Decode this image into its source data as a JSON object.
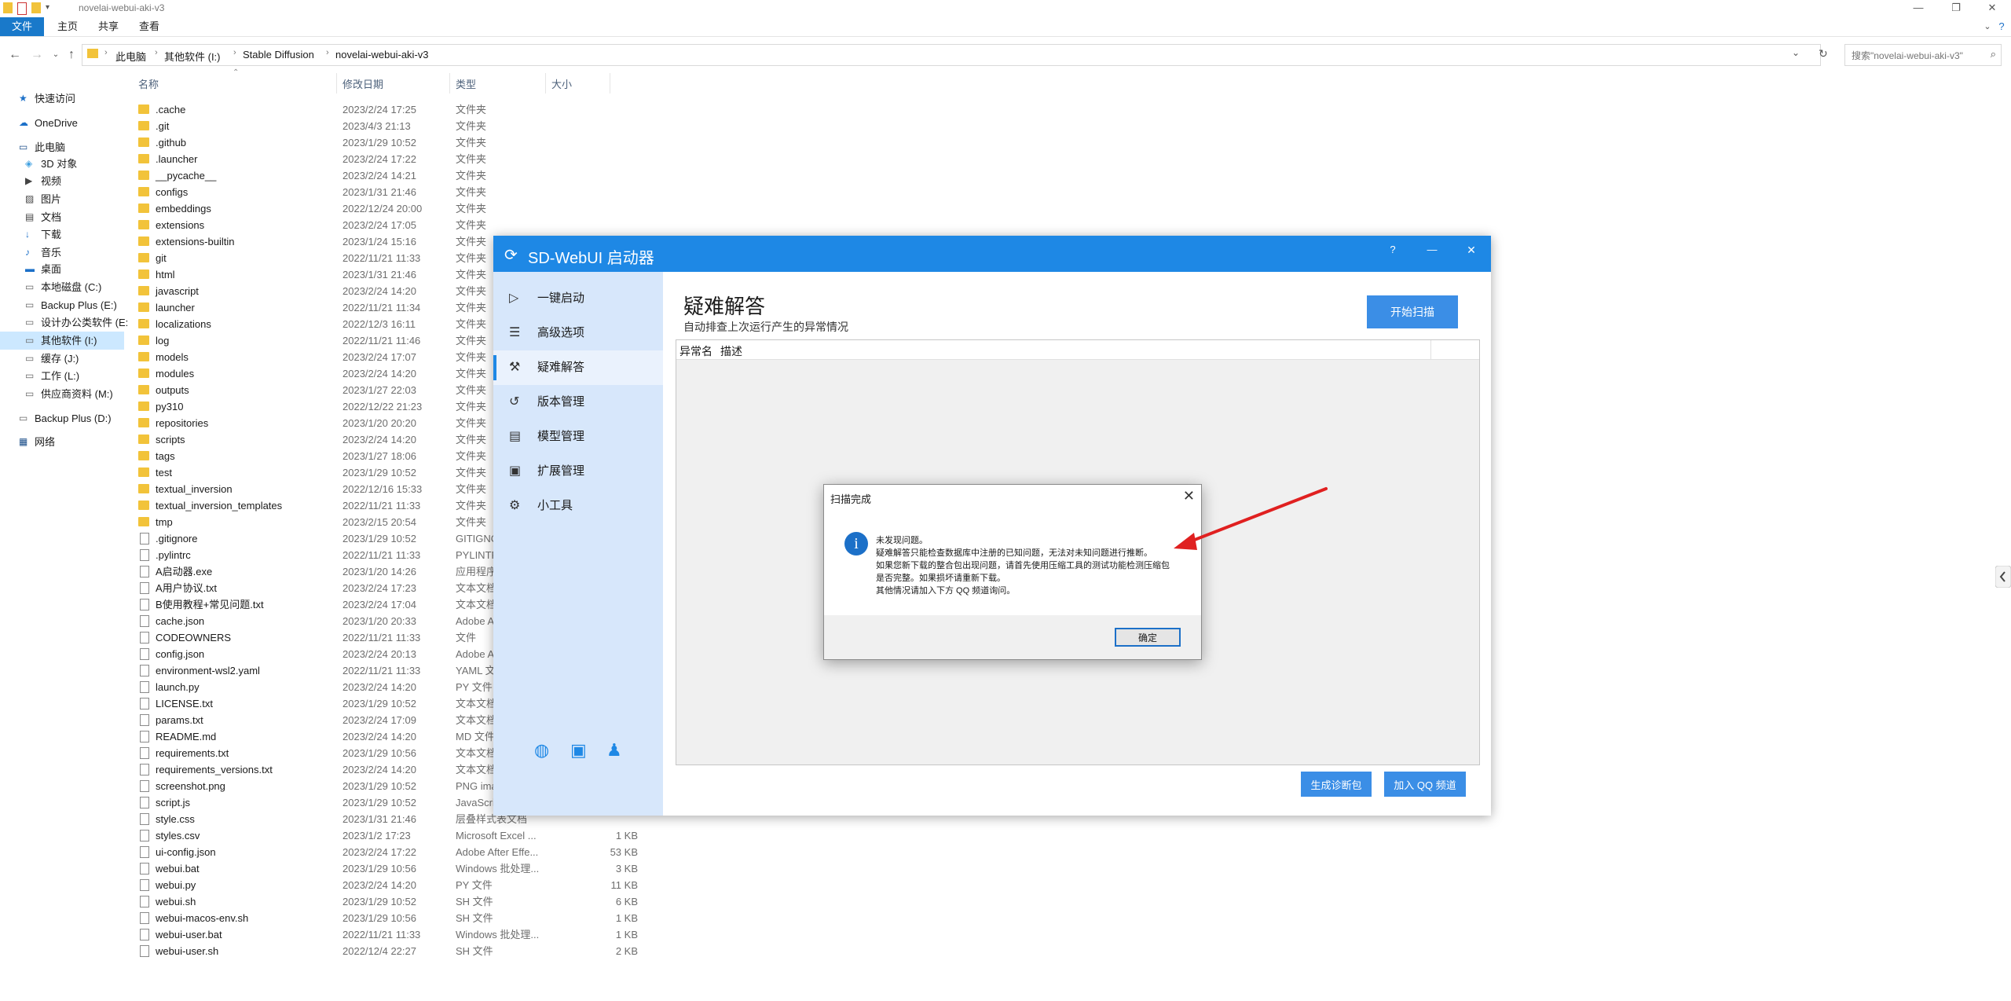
{
  "explorer": {
    "window_title": "novelai-webui-aki-v3",
    "ribbon_tabs": [
      "文件",
      "主页",
      "共享",
      "查看"
    ],
    "breadcrumb": [
      "此电脑",
      "其他软件 (I:)",
      "Stable Diffusion",
      "novelai-webui-aki-v3"
    ],
    "search_placeholder": "搜索\"novelai-webui-aki-v3\"",
    "nav": [
      {
        "label": "快速访问",
        "icon": "star-icon",
        "level": 1
      },
      {
        "label": "OneDrive",
        "icon": "cloud-icon",
        "level": 1
      },
      {
        "label": "此电脑",
        "icon": "computer-icon",
        "level": 1
      },
      {
        "label": "3D 对象",
        "icon": "cube-icon",
        "level": 2
      },
      {
        "label": "视频",
        "icon": "video-icon",
        "level": 2
      },
      {
        "label": "图片",
        "icon": "picture-icon",
        "level": 2
      },
      {
        "label": "文档",
        "icon": "document-icon",
        "level": 2
      },
      {
        "label": "下载",
        "icon": "download-icon",
        "level": 2
      },
      {
        "label": "音乐",
        "icon": "music-icon",
        "level": 2
      },
      {
        "label": "桌面",
        "icon": "desktop-icon",
        "level": 2
      },
      {
        "label": "本地磁盘 (C:)",
        "icon": "drive-icon",
        "level": 2
      },
      {
        "label": "Backup Plus (E:)",
        "icon": "drive-icon",
        "level": 2
      },
      {
        "label": "设计办公类软件 (E:",
        "icon": "drive-icon",
        "level": 2
      },
      {
        "label": "其他软件 (I:)",
        "icon": "drive-icon",
        "level": 2,
        "selected": true
      },
      {
        "label": "缓存 (J:)",
        "icon": "drive-icon",
        "level": 2
      },
      {
        "label": "工作 (L:)",
        "icon": "drive-icon",
        "level": 2
      },
      {
        "label": "供应商资料 (M:)",
        "icon": "drive-icon",
        "level": 2
      },
      {
        "label": "Backup Plus (D:)",
        "icon": "drive-icon",
        "level": 1
      },
      {
        "label": "网络",
        "icon": "network-icon",
        "level": 1
      }
    ],
    "columns": [
      "名称",
      "修改日期",
      "类型",
      "大小"
    ],
    "files": [
      {
        "name": ".cache",
        "date": "2023/2/24 17:25",
        "type": "文件夹",
        "size": "",
        "kind": "folder"
      },
      {
        "name": ".git",
        "date": "2023/4/3 21:13",
        "type": "文件夹",
        "size": "",
        "kind": "folder"
      },
      {
        "name": ".github",
        "date": "2023/1/29 10:52",
        "type": "文件夹",
        "size": "",
        "kind": "folder"
      },
      {
        "name": ".launcher",
        "date": "2023/2/24 17:22",
        "type": "文件夹",
        "size": "",
        "kind": "folder"
      },
      {
        "name": "__pycache__",
        "date": "2023/2/24 14:21",
        "type": "文件夹",
        "size": "",
        "kind": "folder"
      },
      {
        "name": "configs",
        "date": "2023/1/31 21:46",
        "type": "文件夹",
        "size": "",
        "kind": "folder"
      },
      {
        "name": "embeddings",
        "date": "2022/12/24 20:00",
        "type": "文件夹",
        "size": "",
        "kind": "folder"
      },
      {
        "name": "extensions",
        "date": "2023/2/24 17:05",
        "type": "文件夹",
        "size": "",
        "kind": "folder"
      },
      {
        "name": "extensions-builtin",
        "date": "2023/1/24 15:16",
        "type": "文件夹",
        "size": "",
        "kind": "folder"
      },
      {
        "name": "git",
        "date": "2022/11/21 11:33",
        "type": "文件夹",
        "size": "",
        "kind": "folder"
      },
      {
        "name": "html",
        "date": "2023/1/31 21:46",
        "type": "文件夹",
        "size": "",
        "kind": "folder"
      },
      {
        "name": "javascript",
        "date": "2023/2/24 14:20",
        "type": "文件夹",
        "size": "",
        "kind": "folder"
      },
      {
        "name": "launcher",
        "date": "2022/11/21 11:34",
        "type": "文件夹",
        "size": "",
        "kind": "folder"
      },
      {
        "name": "localizations",
        "date": "2022/12/3 16:11",
        "type": "文件夹",
        "size": "",
        "kind": "folder"
      },
      {
        "name": "log",
        "date": "2022/11/21 11:46",
        "type": "文件夹",
        "size": "",
        "kind": "folder"
      },
      {
        "name": "models",
        "date": "2023/2/24 17:07",
        "type": "文件夹",
        "size": "",
        "kind": "folder"
      },
      {
        "name": "modules",
        "date": "2023/2/24 14:20",
        "type": "文件夹",
        "size": "",
        "kind": "folder"
      },
      {
        "name": "outputs",
        "date": "2023/1/27 22:03",
        "type": "文件夹",
        "size": "",
        "kind": "folder"
      },
      {
        "name": "py310",
        "date": "2022/12/22 21:23",
        "type": "文件夹",
        "size": "",
        "kind": "folder"
      },
      {
        "name": "repositories",
        "date": "2023/1/20 20:20",
        "type": "文件夹",
        "size": "",
        "kind": "folder"
      },
      {
        "name": "scripts",
        "date": "2023/2/24 14:20",
        "type": "文件夹",
        "size": "",
        "kind": "folder"
      },
      {
        "name": "tags",
        "date": "2023/1/27 18:06",
        "type": "文件夹",
        "size": "",
        "kind": "folder"
      },
      {
        "name": "test",
        "date": "2023/1/29 10:52",
        "type": "文件夹",
        "size": "",
        "kind": "folder"
      },
      {
        "name": "textual_inversion",
        "date": "2022/12/16 15:33",
        "type": "文件夹",
        "size": "",
        "kind": "folder"
      },
      {
        "name": "textual_inversion_templates",
        "date": "2022/11/21 11:33",
        "type": "文件夹",
        "size": "",
        "kind": "folder"
      },
      {
        "name": "tmp",
        "date": "2023/2/15 20:54",
        "type": "文件夹",
        "size": "",
        "kind": "folder"
      },
      {
        "name": ".gitignore",
        "date": "2023/1/29 10:52",
        "type": "GITIGNO",
        "size": "",
        "kind": "file"
      },
      {
        "name": ".pylintrc",
        "date": "2022/11/21 11:33",
        "type": "PYLINTR",
        "size": "",
        "kind": "file"
      },
      {
        "name": "A启动器.exe",
        "date": "2023/1/20 14:26",
        "type": "应用程序",
        "size": "",
        "kind": "file"
      },
      {
        "name": "A用户协议.txt",
        "date": "2023/2/24 17:23",
        "type": "文本文档",
        "size": "",
        "kind": "file"
      },
      {
        "name": "B使用教程+常见问题.txt",
        "date": "2023/2/24 17:04",
        "type": "文本文档",
        "size": "",
        "kind": "file"
      },
      {
        "name": "cache.json",
        "date": "2023/1/20 20:33",
        "type": "Adobe A",
        "size": "",
        "kind": "file"
      },
      {
        "name": "CODEOWNERS",
        "date": "2022/11/21 11:33",
        "type": "文件",
        "size": "",
        "kind": "file"
      },
      {
        "name": "config.json",
        "date": "2023/2/24 20:13",
        "type": "Adobe A",
        "size": "",
        "kind": "file"
      },
      {
        "name": "environment-wsl2.yaml",
        "date": "2022/11/21 11:33",
        "type": "YAML 文",
        "size": "",
        "kind": "file"
      },
      {
        "name": "launch.py",
        "date": "2023/2/24 14:20",
        "type": "PY 文件",
        "size": "",
        "kind": "file"
      },
      {
        "name": "LICENSE.txt",
        "date": "2023/1/29 10:52",
        "type": "文本文档",
        "size": "",
        "kind": "file"
      },
      {
        "name": "params.txt",
        "date": "2023/2/24 17:09",
        "type": "文本文档",
        "size": "",
        "kind": "file"
      },
      {
        "name": "README.md",
        "date": "2023/2/24 14:20",
        "type": "MD 文件",
        "size": "",
        "kind": "file"
      },
      {
        "name": "requirements.txt",
        "date": "2023/1/29 10:56",
        "type": "文本文档",
        "size": "",
        "kind": "file"
      },
      {
        "name": "requirements_versions.txt",
        "date": "2023/2/24 14:20",
        "type": "文本文档",
        "size": "",
        "kind": "file"
      },
      {
        "name": "screenshot.png",
        "date": "2023/1/29 10:52",
        "type": "PNG ima",
        "size": "",
        "kind": "file"
      },
      {
        "name": "script.js",
        "date": "2023/1/29 10:52",
        "type": "JavaScri",
        "size": "",
        "kind": "file"
      },
      {
        "name": "style.css",
        "date": "2023/1/31 21:46",
        "type": "层叠样式表文档",
        "size": "",
        "kind": "file"
      },
      {
        "name": "styles.csv",
        "date": "2023/1/2 17:23",
        "type": "Microsoft Excel ...",
        "size": "1 KB",
        "kind": "file"
      },
      {
        "name": "ui-config.json",
        "date": "2023/2/24 17:22",
        "type": "Adobe After Effe...",
        "size": "53 KB",
        "kind": "file"
      },
      {
        "name": "webui.bat",
        "date": "2023/1/29 10:56",
        "type": "Windows 批处理...",
        "size": "3 KB",
        "kind": "file"
      },
      {
        "name": "webui.py",
        "date": "2023/2/24 14:20",
        "type": "PY 文件",
        "size": "11 KB",
        "kind": "file"
      },
      {
        "name": "webui.sh",
        "date": "2023/1/29 10:52",
        "type": "SH 文件",
        "size": "6 KB",
        "kind": "file"
      },
      {
        "name": "webui-macos-env.sh",
        "date": "2023/1/29 10:56",
        "type": "SH 文件",
        "size": "1 KB",
        "kind": "file"
      },
      {
        "name": "webui-user.bat",
        "date": "2022/11/21 11:33",
        "type": "Windows 批处理...",
        "size": "1 KB",
        "kind": "file"
      },
      {
        "name": "webui-user.sh",
        "date": "2022/12/4 22:27",
        "type": "SH 文件",
        "size": "2 KB",
        "kind": "file"
      }
    ]
  },
  "launcher": {
    "title": "SD-WebUI 启动器",
    "help": "?",
    "minimize": "—",
    "close": "✕",
    "menu": [
      {
        "label": "一键启动",
        "icon": "play-icon"
      },
      {
        "label": "高级选项",
        "icon": "list-icon"
      },
      {
        "label": "疑难解答",
        "icon": "wrench-icon",
        "active": true
      },
      {
        "label": "版本管理",
        "icon": "history-icon"
      },
      {
        "label": "模型管理",
        "icon": "box-icon"
      },
      {
        "label": "扩展管理",
        "icon": "plugin-icon"
      },
      {
        "label": "小工具",
        "icon": "tools-icon"
      }
    ],
    "heading": "疑难解答",
    "subheading": "自动排查上次运行产生的异常情况",
    "scan_button": "开始扫描",
    "table_headers": [
      "异常名",
      "描述"
    ],
    "diag_button": "生成诊断包",
    "qq_button": "加入 QQ 频道"
  },
  "dialog": {
    "title": "扫描完成",
    "close": "✕",
    "icon_glyph": "i",
    "lines": [
      "未发现问题。",
      "疑难解答只能检查数据库中注册的已知问题，无法对未知问题进行推断。",
      "如果您新下载的整合包出现问题，请首先使用压缩工具的测试功能检测压缩包",
      "是否完整。如果损坏请重新下载。",
      "其他情况请加入下方 QQ 频道询问。"
    ],
    "ok": "确定"
  },
  "colors": {
    "accent": "#1e88e5",
    "sidebar": "#d7e7fb",
    "annotation": "#e02020"
  }
}
